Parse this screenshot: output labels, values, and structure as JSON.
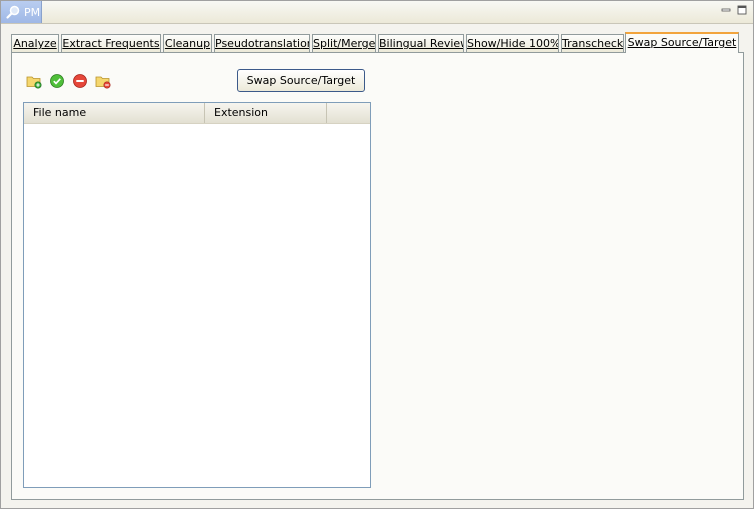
{
  "titlebar": {
    "title": "PM",
    "app_icon": "search-icon",
    "buttons": [
      {
        "name": "minimize-icon"
      },
      {
        "name": "maximize-icon"
      }
    ]
  },
  "tabs": [
    {
      "label": "Analyze",
      "active": false
    },
    {
      "label": "Extract Frequents",
      "active": false
    },
    {
      "label": "Cleanup",
      "active": false
    },
    {
      "label": "Pseudotranslation",
      "active": false
    },
    {
      "label": "Split/Merge",
      "active": false
    },
    {
      "label": "Bilingual Review",
      "active": false
    },
    {
      "label": "Show/Hide 100%",
      "active": false
    },
    {
      "label": "Transcheck",
      "active": false
    },
    {
      "label": "Swap Source/Target",
      "active": true
    }
  ],
  "toolbar": {
    "icons": [
      "add-folder-icon",
      "check-icon",
      "remove-icon",
      "remove-folder-icon"
    ],
    "swap_button_label": "Swap Source/Target"
  },
  "table": {
    "columns": [
      "File name",
      "Extension"
    ],
    "rows": []
  },
  "colors": {
    "active_tab_accent": "#f2a43c",
    "titlebar_view": "#9fb8e6",
    "table_border": "#7f9db9"
  }
}
